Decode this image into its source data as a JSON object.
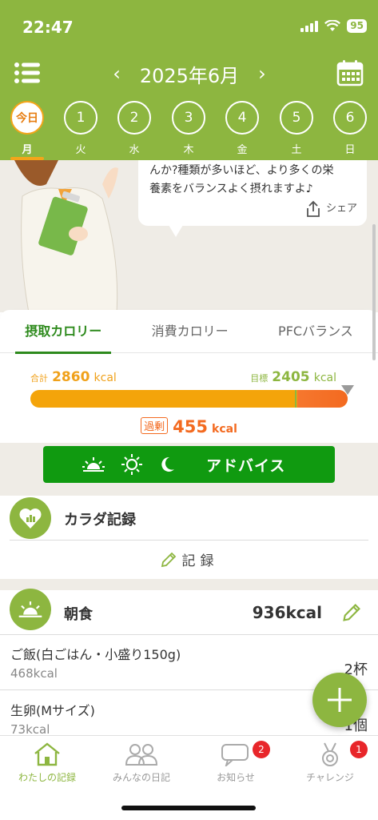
{
  "status": {
    "time": "22:47",
    "battery": "95"
  },
  "nav": {
    "prev": "‹",
    "month_title": "2025年6月",
    "next": "›"
  },
  "days": [
    {
      "num": "今日",
      "label": "月",
      "today": true
    },
    {
      "num": "1",
      "label": "火"
    },
    {
      "num": "2",
      "label": "水"
    },
    {
      "num": "3",
      "label": "木"
    },
    {
      "num": "4",
      "label": "金"
    },
    {
      "num": "5",
      "label": "土"
    },
    {
      "num": "6",
      "label": "日"
    }
  ],
  "advice": {
    "line1": "んか?種類が多いほど、より多くの栄",
    "line2": "養素をバランスよく摂れますよ♪",
    "share": "シェア"
  },
  "calorie_tabs": [
    "摂取カロリー",
    "消費カロリー",
    "PFCバランス"
  ],
  "calories": {
    "total_label": "合計",
    "total_value": "2860",
    "goal_label": "目標",
    "goal_value": "2405",
    "unit": "kcal",
    "over_label": "過剰",
    "over_value": "455",
    "goal_fraction": 0.841
  },
  "advice_button": {
    "label": "アドバイス"
  },
  "body_record": {
    "title": "カラダ記録",
    "link": "記録"
  },
  "breakfast": {
    "title": "朝食",
    "kcal": "936kcal",
    "items": [
      {
        "name": "ご飯(白ごはん・小盛り150g)",
        "kcal": "468kcal",
        "qty": "2杯"
      },
      {
        "name": "生卵(Mサイズ)",
        "kcal": "73kcal",
        "qty": "1個"
      }
    ]
  },
  "tabbar": [
    {
      "label": "わたしの記録",
      "active": true
    },
    {
      "label": "みんなの日記"
    },
    {
      "label": "お知らせ",
      "badge": "2"
    },
    {
      "label": "チャレンジ",
      "badge": "1"
    }
  ],
  "colors": {
    "brand_green": "#8db640",
    "advice_green": "#109a10",
    "over_orange": "#f36a20",
    "intake_orange": "#f4a40a"
  }
}
